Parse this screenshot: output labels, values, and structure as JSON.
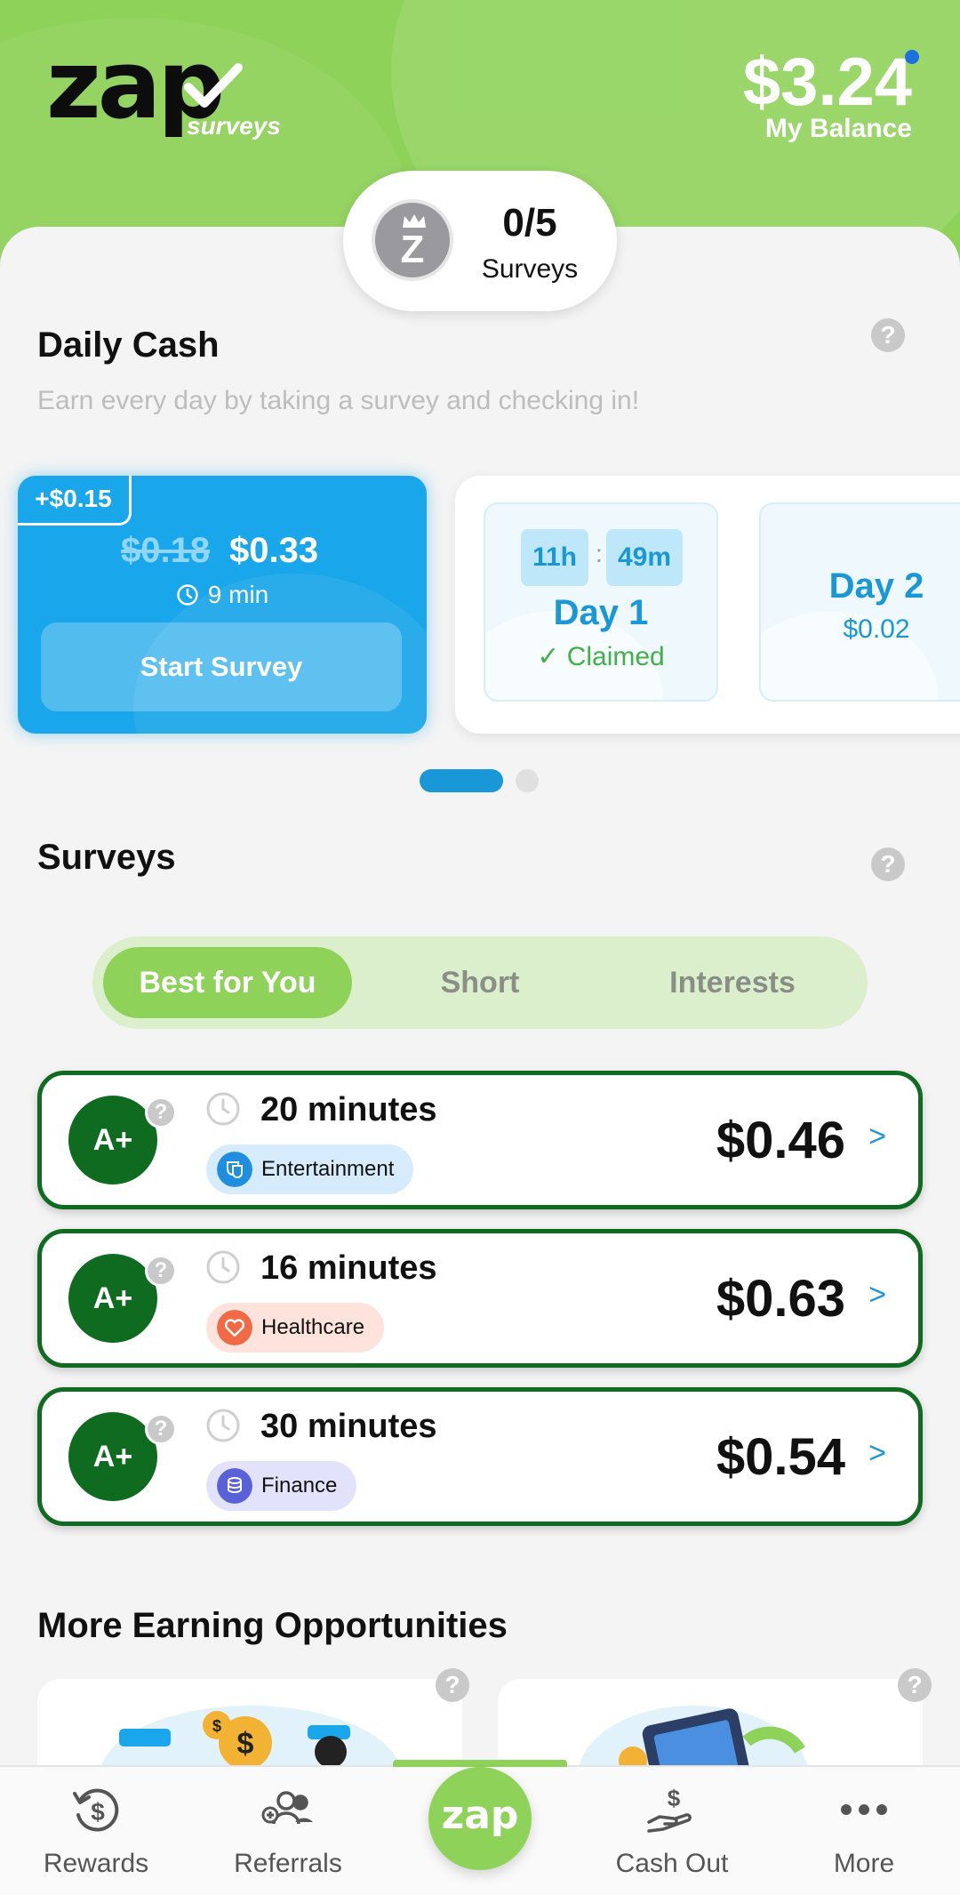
{
  "header": {
    "logo_text": "zap",
    "logo_sub": "surveys",
    "balance_amount": "$3.24",
    "balance_label": "My Balance"
  },
  "progress": {
    "count": "0/5",
    "label": "Surveys",
    "avatar_letter": "Z"
  },
  "daily_cash": {
    "title": "Daily Cash",
    "subtitle": "Earn every day by taking a survey and checking in!",
    "help": "?",
    "offer": {
      "badge": "+$0.15",
      "old_price": "$0.18",
      "new_price": "$0.33",
      "duration": "9 min",
      "button": "Start Survey"
    },
    "days": [
      {
        "timer_h": "11h",
        "colon": ":",
        "timer_m": "49m",
        "title": "Day 1",
        "status": "✓ Claimed"
      },
      {
        "title": "Day 2",
        "amount": "$0.02"
      }
    ]
  },
  "surveys": {
    "title": "Surveys",
    "help": "?",
    "tabs": [
      "Best for You",
      "Short",
      "Interests"
    ],
    "active_tab": 0,
    "items": [
      {
        "grade": "A+",
        "time": "20 minutes",
        "category": "Entertainment",
        "price": "$0.46",
        "color": "#d6ebfb",
        "icon_color": "#1f8ee0"
      },
      {
        "grade": "A+",
        "time": "16 minutes",
        "category": "Healthcare",
        "price": "$0.63",
        "color": "#fde3dc",
        "icon_color": "#f06a45"
      },
      {
        "grade": "A+",
        "time": "30 minutes",
        "category": "Finance",
        "price": "$0.54",
        "color": "#e2e3fb",
        "icon_color": "#5a60d8"
      }
    ],
    "arrow": ">"
  },
  "more": {
    "title": "More Earning Opportunities",
    "help": "?"
  },
  "nav": {
    "items": [
      "Rewards",
      "Referrals",
      "Cash Out",
      "More"
    ],
    "center": "zap"
  },
  "colors": {
    "brand_green": "#8fd25a",
    "accent_blue": "#1a97d6",
    "survey_border": "#0f6b1f"
  }
}
